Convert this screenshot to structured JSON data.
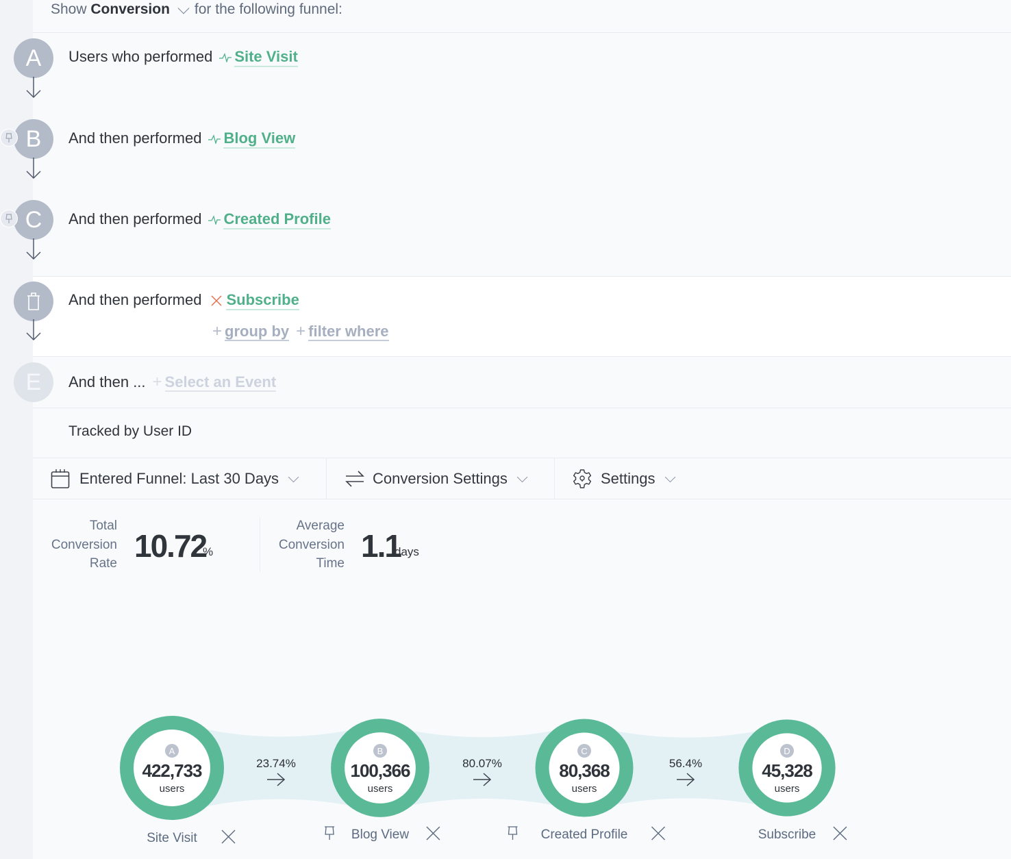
{
  "header": {
    "show_prefix": "Show",
    "metric_selected": "Conversion",
    "suffix": "for the following funnel:"
  },
  "steps": [
    {
      "badge": "A",
      "prefix": "Users who performed",
      "event": "Site Visit",
      "icon": "activity-icon",
      "pinned": false
    },
    {
      "badge": "B",
      "prefix": "And then performed",
      "event": "Blog View",
      "icon": "activity-icon",
      "pinned": true
    },
    {
      "badge": "C",
      "prefix": "And then performed",
      "event": "Created Profile",
      "icon": "activity-icon",
      "pinned": true
    },
    {
      "badge": "trash-icon",
      "prefix": "And then performed",
      "event": "Subscribe",
      "icon": "remove-x-icon",
      "pinned": false,
      "actions": {
        "group_by": "group by",
        "filter_where": "filter where"
      }
    },
    {
      "badge": "E",
      "prefix": "And then ...",
      "placeholder": "Select an Event"
    }
  ],
  "tracked_by": "Tracked by User ID",
  "toolbar": {
    "date_range": "Entered Funnel: Last 30 Days",
    "conversion_settings": "Conversion Settings",
    "settings": "Settings"
  },
  "metrics": {
    "total_conversion": {
      "label_lines": [
        "Total",
        "Conversion",
        "Rate"
      ],
      "value": "10.72",
      "unit": "%"
    },
    "avg_time": {
      "label_lines": [
        "Average",
        "Conversion",
        "Time"
      ],
      "value": "1.1",
      "unit": "days"
    }
  },
  "colors": {
    "accent_green": "#5aba98",
    "band": "#e3f1f5",
    "badge_gray": "#b3bbc8",
    "remove_red": "#e4704f"
  },
  "chart_data": {
    "type": "funnel",
    "nodes": [
      {
        "badge": "A",
        "label": "Site Visit",
        "users": 422733,
        "users_text": "422,733",
        "unit": "users",
        "pinned": false
      },
      {
        "badge": "B",
        "label": "Blog View",
        "users": 100366,
        "users_text": "100,366",
        "unit": "users",
        "pinned": true
      },
      {
        "badge": "C",
        "label": "Created Profile",
        "users": 80368,
        "users_text": "80,368",
        "unit": "users",
        "pinned": true
      },
      {
        "badge": "D",
        "label": "Subscribe",
        "users": 45328,
        "users_text": "45,328",
        "unit": "users",
        "pinned": false
      }
    ],
    "conversions": [
      "23.74%",
      "80.07%",
      "56.4%"
    ]
  }
}
